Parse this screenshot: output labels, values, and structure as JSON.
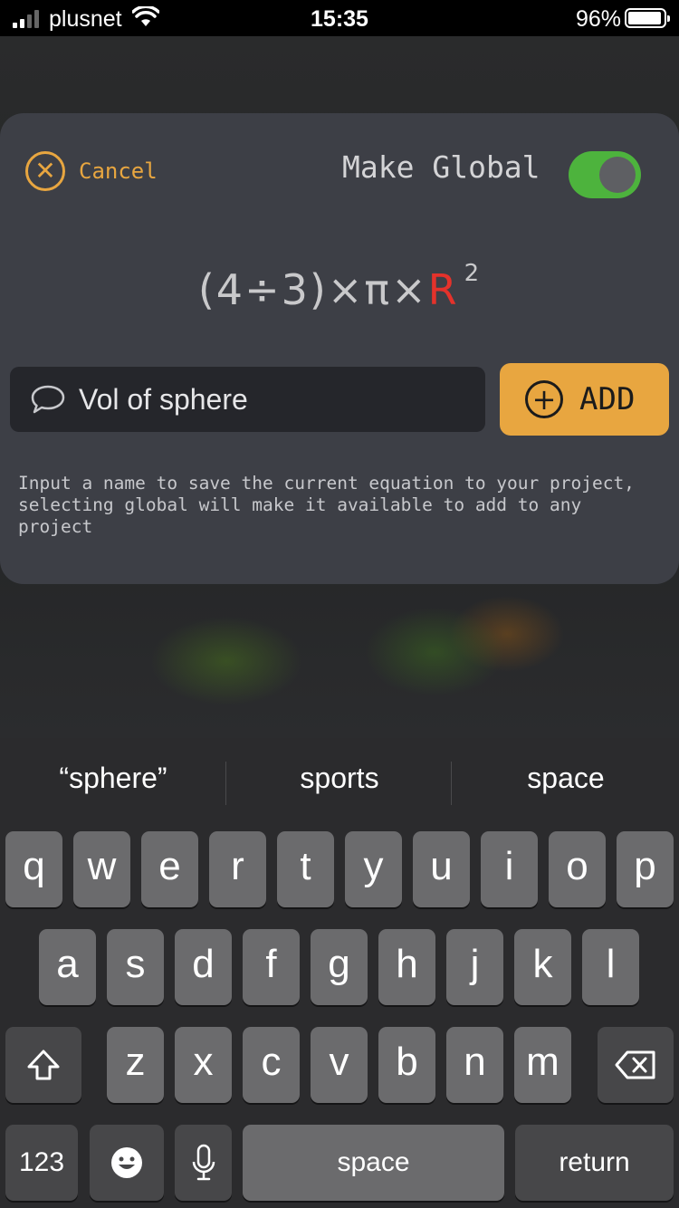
{
  "status": {
    "carrier": "plusnet",
    "time": "15:35",
    "battery": "96%",
    "signal_bars": 4,
    "signal_filled": 2
  },
  "modal": {
    "cancel_label": "Cancel",
    "make_global_label": "Make Global",
    "make_global_on": true,
    "equation": {
      "prefix": "(4÷3)×π×",
      "variable": "R",
      "exponent": "2"
    },
    "name_value": "Vol of sphere",
    "add_label": "ADD",
    "help_text": "Input a name to save the current equation to your project, selecting global will make it available to add to any project"
  },
  "keyboard": {
    "suggestions": [
      "“sphere”",
      "sports",
      "space"
    ],
    "row1": [
      "q",
      "w",
      "e",
      "r",
      "t",
      "y",
      "u",
      "i",
      "o",
      "p"
    ],
    "row2": [
      "a",
      "s",
      "d",
      "f",
      "g",
      "h",
      "j",
      "k",
      "l"
    ],
    "row3": [
      "z",
      "x",
      "c",
      "v",
      "b",
      "n",
      "m"
    ],
    "numbers_label": "123",
    "space_label": "space",
    "return_label": "return"
  },
  "colors": {
    "accent": "#e8a640",
    "toggle_on": "#4db33d",
    "variable": "#e4322b",
    "modal_bg": "#3d3f46"
  }
}
